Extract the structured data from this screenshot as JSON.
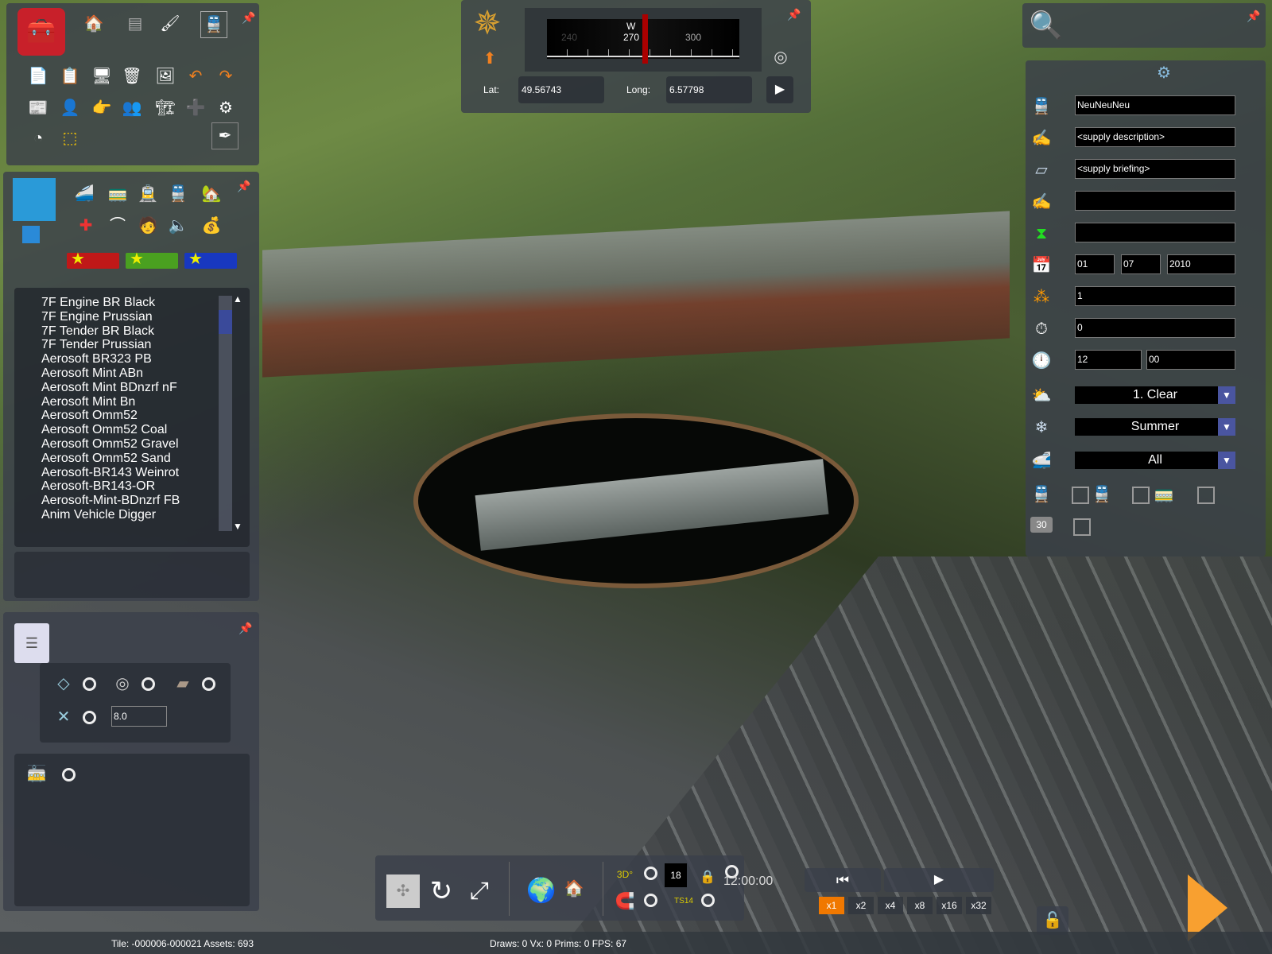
{
  "compass": {
    "heading_label": "W",
    "ticks": [
      "240",
      "270",
      "300"
    ],
    "lat_label": "Lat:",
    "lat": "49.56743",
    "long_label": "Long:",
    "long": "6.57798"
  },
  "asset_list": [
    "7F Engine BR Black",
    "7F Engine Prussian",
    "7F Tender BR Black",
    "7F Tender Prussian",
    "Aerosoft BR323 PB",
    "Aerosoft Mint ABn",
    "Aerosoft Mint BDnzrf nF",
    "Aerosoft Mint Bn",
    "Aerosoft Omm52",
    "Aerosoft Omm52 Coal",
    "Aerosoft Omm52 Gravel",
    "Aerosoft Omm52 Sand",
    "Aerosoft-BR143 Weinrot",
    "Aerosoft-BR143-OR",
    "Aerosoft-Mint-BDnzrf FB",
    "Anim Vehicle Digger"
  ],
  "options": {
    "height_value": "8.0"
  },
  "scenario": {
    "name": "NeuNeuNeu",
    "description": "<supply description>",
    "briefing": "<supply briefing>",
    "extra1": "",
    "extra2": "",
    "day": "01",
    "month": "07",
    "year": "2010",
    "difficulty": "1",
    "duration": "0",
    "hour": "12",
    "minute": "00",
    "weather": "1. Clear",
    "season": "Summer",
    "filter": "All"
  },
  "toolbar": {
    "sim_time": "12:00:00",
    "layer_number": "18",
    "speeds": [
      "x1",
      "x2",
      "x4",
      "x8",
      "x16",
      "x32"
    ],
    "active_speed": "x1"
  },
  "status": {
    "tile": "Tile: -000006-000021  Assets: 693",
    "stats": "Draws: 0 Vx: 0 Prims: 0 FPS: 67"
  },
  "colors": {
    "accent": "#f07800",
    "panel": "#3a404a",
    "dropdown_arrow": "#4a55a0"
  }
}
